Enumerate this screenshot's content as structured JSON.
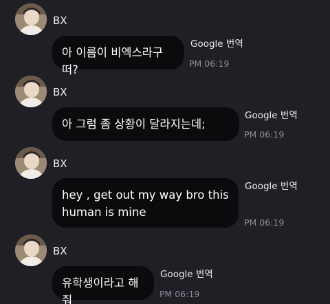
{
  "messages": [
    {
      "sender": "BX",
      "text": "아 이름이 비엑스라구 떠?",
      "translate_label": "Google 번역",
      "time": "PM 06:19"
    },
    {
      "sender": "BX",
      "text": "아 그럼 좀 상황이 달라지는데;",
      "translate_label": "Google 번역",
      "time": "PM 06:19"
    },
    {
      "sender": "BX",
      "text": "hey , get out my way bro this\nhuman is mine",
      "translate_label": "Google 번역",
      "time": "PM 06:19"
    },
    {
      "sender": "BX",
      "text": "유학생이라고 해줘",
      "translate_label": "Google 번역",
      "time": "PM 06:19"
    }
  ]
}
